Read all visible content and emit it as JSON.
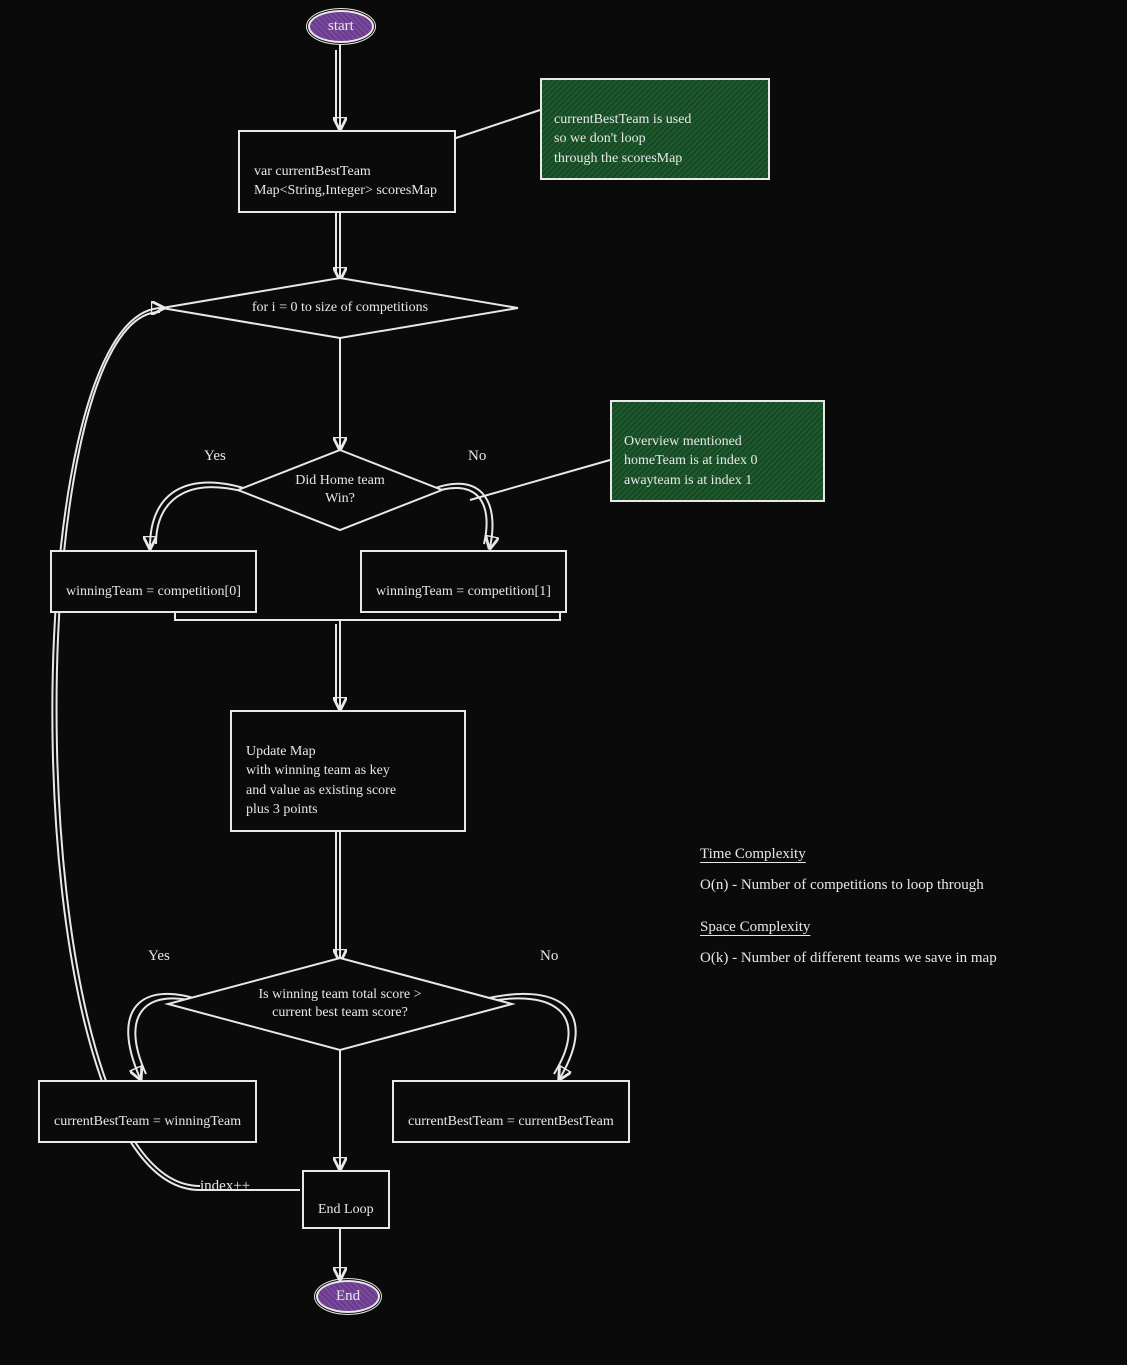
{
  "diagram": {
    "type": "flowchart",
    "theme": "chalkboard",
    "terminators": {
      "start": "start",
      "end": "End"
    },
    "process": {
      "init": "var currentBestTeam\nMap<String,Integer> scoresMap",
      "win_home": "winningTeam = competition[0]",
      "win_away": "winningTeam = competition[1]",
      "update_map": "Update Map\nwith winning team as key\nand value as existing score\nplus 3 points",
      "set_best_yes": "currentBestTeam = winningTeam",
      "set_best_no": "currentBestTeam = currentBestTeam",
      "end_loop": "End Loop"
    },
    "decisions": {
      "loop": "for i = 0 to size of competitions",
      "home_win": "Did Home team\nWin?",
      "compare": "Is winning team total score >\ncurrent best team score?"
    },
    "notes": {
      "n1": "currentBestTeam is used\nso we don't loop\nthrough the scoresMap",
      "n2": "Overview mentioned\nhomeTeam is at index 0\nawayteam is at index 1"
    },
    "labels": {
      "yes1": "Yes",
      "no1": "No",
      "yes2": "Yes",
      "no2": "No",
      "loop_back": "index++"
    }
  },
  "complexity": {
    "time_heading": "Time Complexity",
    "time_body": "O(n) - Number of competitions to loop through",
    "space_heading": "Space Complexity",
    "space_body": "O(k) - Number of different teams we save in map"
  }
}
